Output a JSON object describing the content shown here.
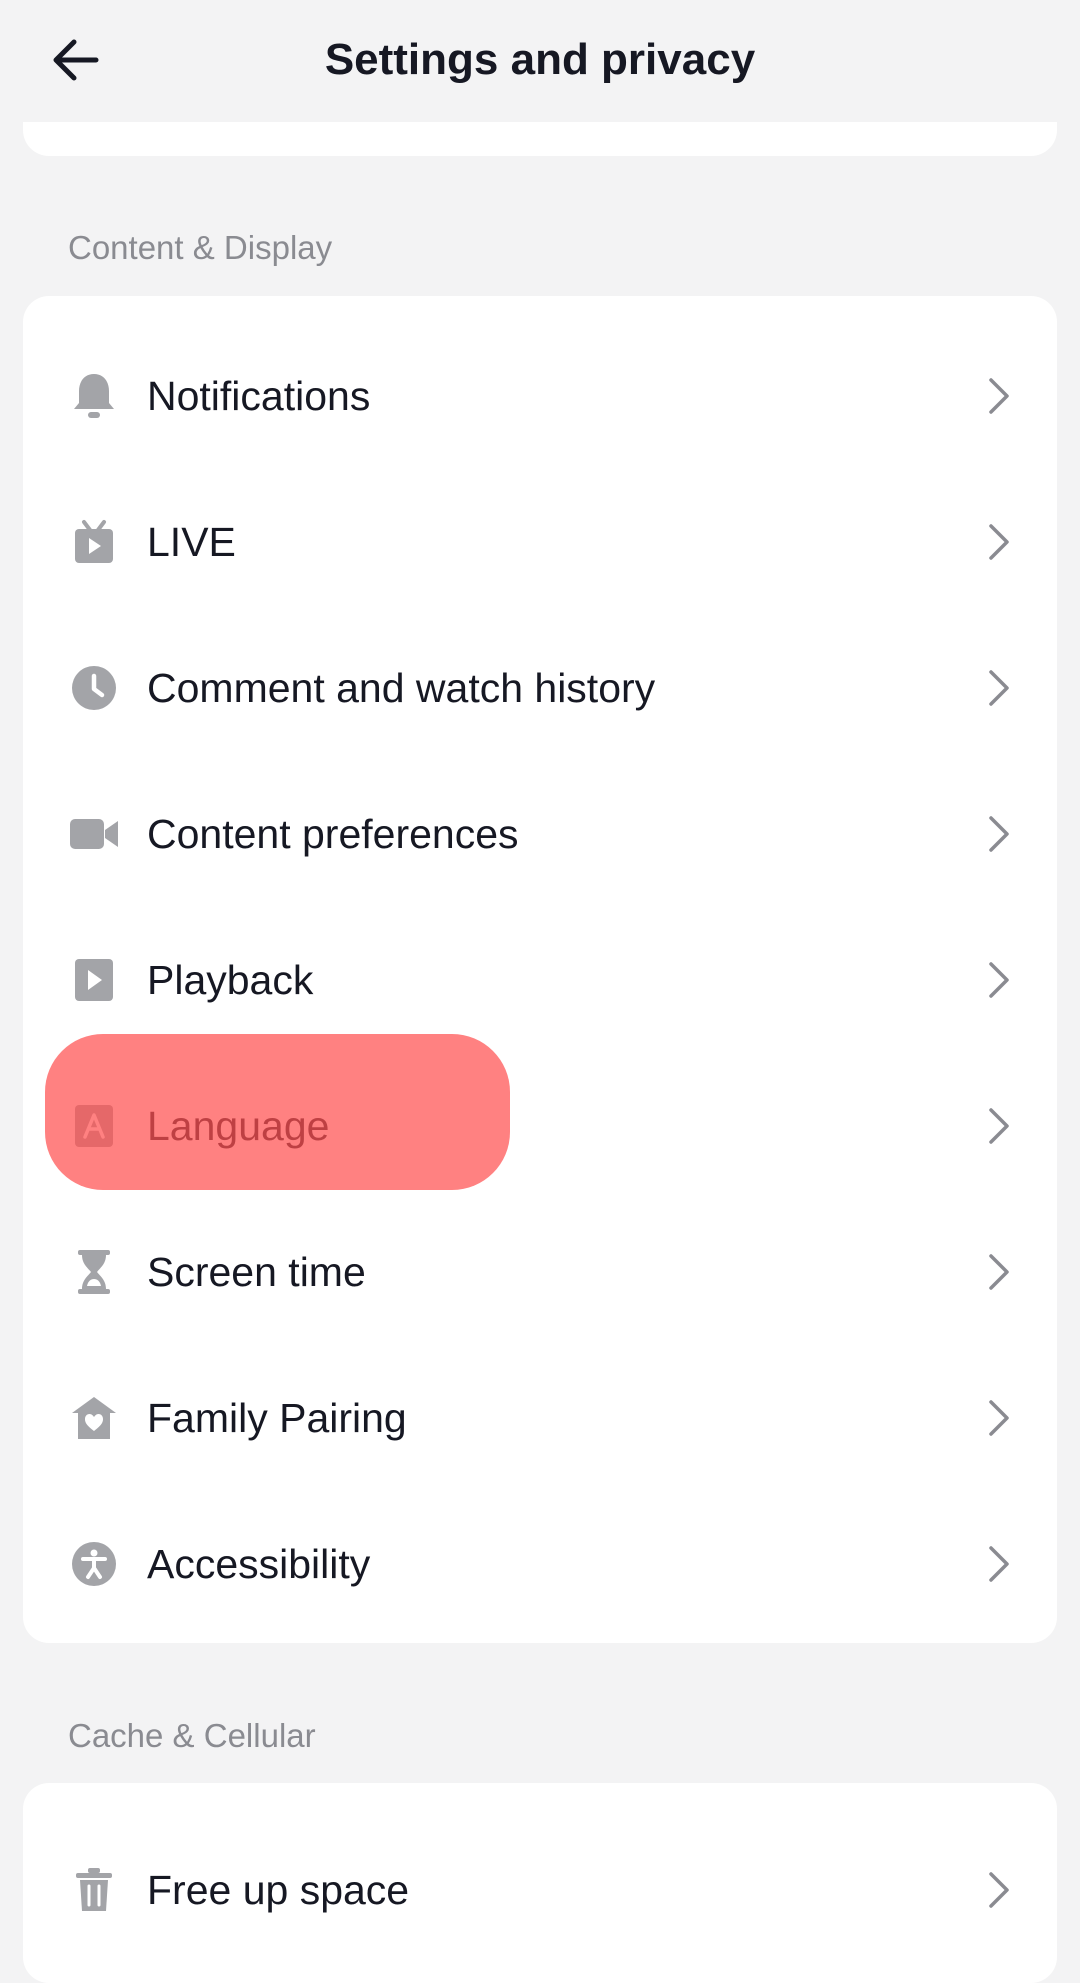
{
  "header": {
    "title": "Settings and privacy",
    "back_icon": "arrow-left-icon"
  },
  "sections": [
    {
      "label": "Content & Display",
      "items": [
        {
          "label": "Notifications",
          "icon": "bell-icon"
        },
        {
          "label": "LIVE",
          "icon": "tv-icon"
        },
        {
          "label": "Comment and watch history",
          "icon": "clock-icon"
        },
        {
          "label": "Content preferences",
          "icon": "video-camera-icon"
        },
        {
          "label": "Playback",
          "icon": "play-icon"
        },
        {
          "label": "Language",
          "icon": "language-icon"
        },
        {
          "label": "Screen time",
          "icon": "hourglass-icon"
        },
        {
          "label": "Family Pairing",
          "icon": "home-heart-icon"
        },
        {
          "label": "Accessibility",
          "icon": "accessibility-icon"
        }
      ]
    },
    {
      "label": "Cache & Cellular",
      "items": [
        {
          "label": "Free up space",
          "icon": "trash-icon"
        }
      ]
    }
  ],
  "colors": {
    "background": "#f3f3f4",
    "card": "#ffffff",
    "text": "#161823",
    "icon": "#a3a4a8",
    "section_label": "#8a8b91",
    "highlight": "#ff5050"
  }
}
